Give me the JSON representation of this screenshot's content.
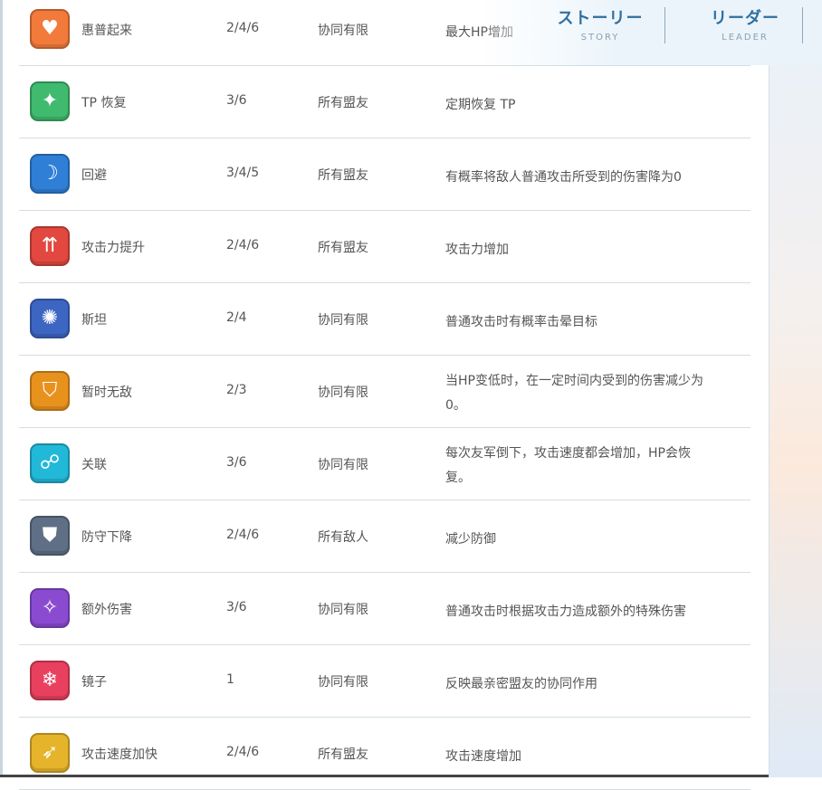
{
  "nav": {
    "story_jp": "ストーリー",
    "story_en": "STORY",
    "leader_jp": "リーダー",
    "leader_en": "LEADER"
  },
  "rows": [
    {
      "icon": "heart-icon",
      "icon_color": "#f27a3a",
      "glyph": "♥",
      "name": "惠普起来",
      "level": "2/4/6",
      "target": "协同有限",
      "effect": [
        "最大HP增加"
      ]
    },
    {
      "icon": "sparkle-up-icon",
      "icon_color": "#3fba6e",
      "glyph": "✦",
      "name": "TP 恢复",
      "level": "3/6",
      "target": "所有盟友",
      "effect": [
        "定期恢复 TP"
      ]
    },
    {
      "icon": "dodge-icon",
      "icon_color": "#2f7fd6",
      "glyph": "☽",
      "name": "回避",
      "level": "3/4/5",
      "target": "所有盟友",
      "effect": [
        "有概率将敌人普通攻击所受到的伤害降为0"
      ]
    },
    {
      "icon": "attack-up-icon",
      "icon_color": "#e2483f",
      "glyph": "⇈",
      "name": "攻击力提升",
      "level": "2/4/6",
      "target": "所有盟友",
      "effect": [
        "攻击力增加"
      ]
    },
    {
      "icon": "stun-icon",
      "icon_color": "#3c66c2",
      "glyph": "✺",
      "name": "斯坦",
      "level": "2/4",
      "target": "协同有限",
      "effect": [
        "普通攻击时有概率击晕目标"
      ]
    },
    {
      "icon": "invincible-icon",
      "icon_color": "#e8921e",
      "glyph": "⛉",
      "name": "暂时无敌",
      "level": "2/3",
      "target": "协同有限",
      "effect": [
        "当HP变低时，在一定时间内受到的伤害减少为",
        "0。"
      ]
    },
    {
      "icon": "link-icon",
      "icon_color": "#22b8d8",
      "glyph": "☍",
      "name": "关联",
      "level": "3/6",
      "target": "协同有限",
      "effect": [
        "每次友军倒下，攻击速度都会增加，HP会恢",
        "复。"
      ]
    },
    {
      "icon": "defense-down-icon",
      "icon_color": "#5f6f86",
      "glyph": "⛊",
      "name": "防守下降",
      "level": "2/4/6",
      "target": "所有敌人",
      "effect": [
        "减少防御"
      ]
    },
    {
      "icon": "extra-damage-icon",
      "icon_color": "#8a4bd1",
      "glyph": "✧",
      "name": "额外伤害",
      "level": "3/6",
      "target": "协同有限",
      "effect": [
        "普通攻击时根据攻击力造成额外的特殊伤害"
      ]
    },
    {
      "icon": "mirror-icon",
      "icon_color": "#e8405e",
      "glyph": "❄",
      "name": "镜子",
      "level": "1",
      "target": "协同有限",
      "effect": [
        "反映最亲密盟友的协同作用"
      ]
    },
    {
      "icon": "attack-speed-icon",
      "icon_color": "#e6b42a",
      "glyph": "➶",
      "name": "攻击速度加快",
      "level": "2/4/6",
      "target": "所有盟友",
      "effect": [
        "攻击速度增加"
      ]
    }
  ]
}
